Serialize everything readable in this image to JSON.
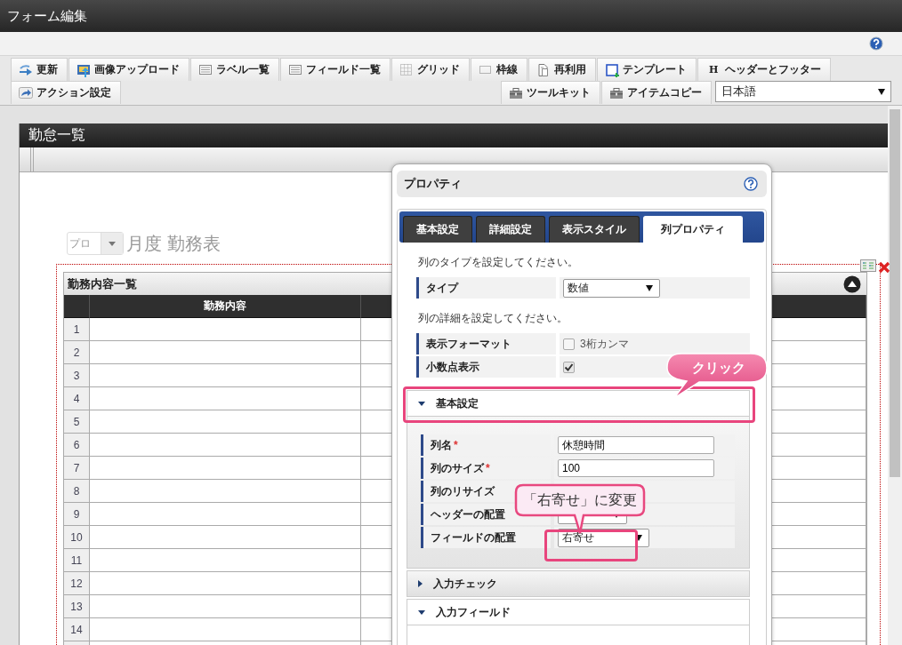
{
  "window": {
    "title": "フォーム編集"
  },
  "toolbar": {
    "row_1": [
      {
        "label": "更新"
      },
      {
        "label": "画像アップロード"
      },
      {
        "label": "ラベル一覧"
      },
      {
        "label": "フィールド一覧"
      },
      {
        "label": "グリッド"
      },
      {
        "label": "枠線"
      },
      {
        "label": "再利用"
      },
      {
        "label": "テンプレート"
      },
      {
        "label": "ヘッダーとフッター",
        "icon_text": "H"
      }
    ],
    "row_2_left": [
      {
        "label": "アクション設定"
      }
    ],
    "row_2_right": [
      {
        "label": "ツールキット"
      },
      {
        "label": "アイテムコピー"
      }
    ],
    "language_select": {
      "value": "日本語"
    }
  },
  "form": {
    "title": "勤怠一覧",
    "heading_select": {
      "value": "プロ"
    },
    "heading": "月度 勤務表",
    "table": {
      "title": "勤務内容一覧",
      "columns": [
        "勤務内容"
      ],
      "rows": [
        "1",
        "2",
        "3",
        "4",
        "5",
        "6",
        "7",
        "8",
        "9",
        "10",
        "11",
        "12",
        "13",
        "14"
      ]
    }
  },
  "dialog": {
    "title": "プロパティ",
    "tabs": [
      {
        "label": "基本設定",
        "selected": false
      },
      {
        "label": "詳細設定",
        "selected": false
      },
      {
        "label": "表示スタイル",
        "selected": false
      },
      {
        "label": "列プロパティ",
        "selected": true
      }
    ],
    "type_hint": "列のタイプを設定してください。",
    "type_rows": [
      {
        "label": "タイプ",
        "kind": "select",
        "value": "数値"
      }
    ],
    "detail_hint": "列の詳細を設定してください。",
    "detail_rows": [
      {
        "label": "表示フォーマット",
        "kind": "checkbox",
        "checked": false,
        "text": "3桁カンマ"
      },
      {
        "label": "小数点表示",
        "kind": "checkbox",
        "checked": true
      }
    ],
    "sections": [
      {
        "title": "基本設定",
        "expanded": true,
        "fields": [
          {
            "label": "列名",
            "required_mark": "*",
            "kind": "text",
            "value": "休憩時間"
          },
          {
            "label": "列のサイズ",
            "required_mark": "*",
            "kind": "text",
            "value": "100"
          },
          {
            "label": "列のリサイズ",
            "kind": "none"
          },
          {
            "label": "ヘッダーの配置",
            "kind": "select"
          },
          {
            "label": "フィールドの配置",
            "kind": "select",
            "value": "右寄せ"
          }
        ]
      },
      {
        "title": "入力チェック",
        "expanded": false
      },
      {
        "title": "入力フィールド",
        "expanded": true
      }
    ]
  },
  "callouts": [
    {
      "text": "クリック",
      "kind": "bold"
    },
    {
      "text": "「右寄せ」に変更",
      "kind": "light"
    }
  ]
}
